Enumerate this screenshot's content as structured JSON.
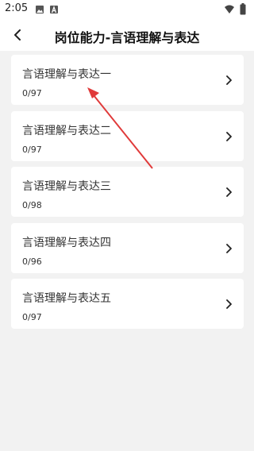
{
  "status": {
    "time": "2:05",
    "icons": [
      "image-icon",
      "a-icon",
      "wifi-icon",
      "battery-icon"
    ]
  },
  "header": {
    "title": "岗位能力-言语理解与表达"
  },
  "items": [
    {
      "title": "言语理解与表达一",
      "count": "0/97"
    },
    {
      "title": "言语理解与表达二",
      "count": "0/97"
    },
    {
      "title": "言语理解与表达三",
      "count": "0/98"
    },
    {
      "title": "言语理解与表达四",
      "count": "0/96"
    },
    {
      "title": "言语理解与表达五",
      "count": "0/97"
    }
  ],
  "colors": {
    "annotation_arrow": "#e03a3a",
    "background": "#f2f2f2"
  }
}
